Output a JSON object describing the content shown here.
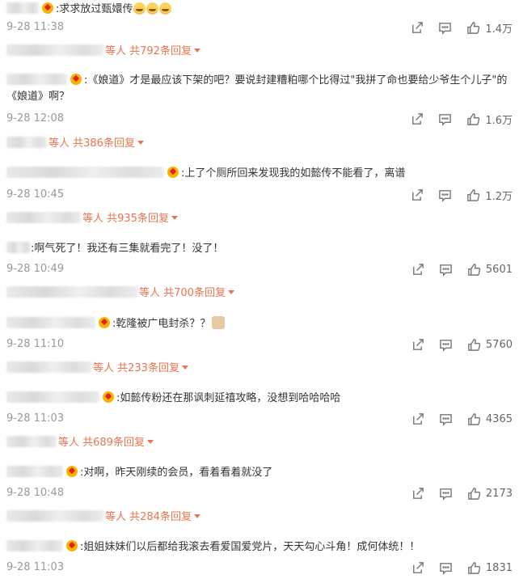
{
  "colors": {
    "accent": "#eb7350",
    "muted": "#999999",
    "icon": "#777777",
    "badge": "#f5b400"
  },
  "comments": [
    {
      "text": ":求求放过甄嬛传",
      "time": "9-28 11:38",
      "likes": "1.4万",
      "replies": "等人 共792条回复"
    },
    {
      "text": ":《娘道》才是最应该下架的吧？要说封建糟粕哪个比得过\"我拼了命也要给少爷生个儿子\"的《娘道》啊？",
      "time": "9-28 12:08",
      "likes": "1.6万",
      "replies": "等人 共386条回复"
    },
    {
      "text": ":上了个厕所回来发现我的如懿传不能看了，离谱",
      "time": "9-28 10:45",
      "likes": "1.2万",
      "replies": "等人 共935条回复"
    },
    {
      "text": ":啊气死了！我还有三集就看完了！没了！",
      "time": "9-28 10:49",
      "likes": "5601",
      "replies": "等人 共700条回复"
    },
    {
      "text": ":乾隆被广电封杀？？",
      "time": "9-28 11:10",
      "likes": "5760",
      "replies": "等人 共233条回复"
    },
    {
      "text": ":如懿传粉还在那讽刺延禧攻略，没想到哈哈哈哈",
      "time": "9-28 11:03",
      "likes": "4365",
      "replies": "等人 共689条回复"
    },
    {
      "text": ":对啊，昨天刚续的会员，看着看着就没了",
      "time": "9-28 10:48",
      "likes": "2173",
      "replies": "等人 共284条回复"
    },
    {
      "text": ":姐姐妹妹们以后都给我滚去看爱国爱党片，天天勾心斗角！成何体统！！",
      "time": "9-28 11:03",
      "likes": "1831"
    }
  ]
}
